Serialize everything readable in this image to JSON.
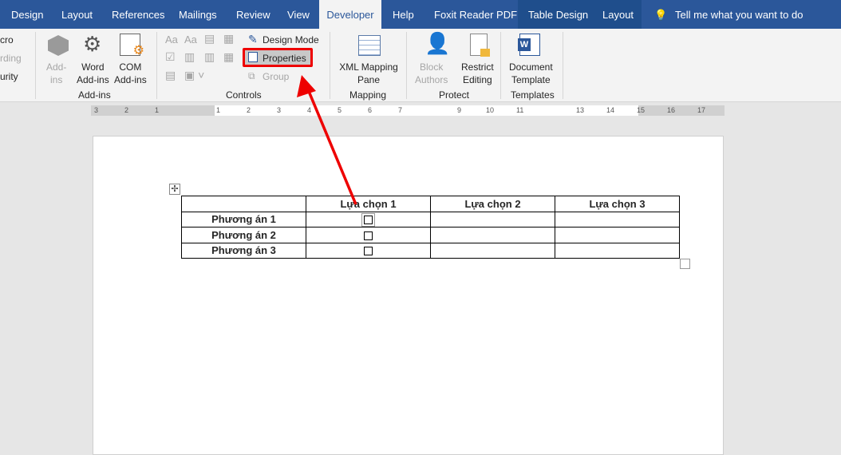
{
  "tabs": [
    "Design",
    "Layout",
    "References",
    "Mailings",
    "Review",
    "View",
    "Developer",
    "Help",
    "Foxit Reader PDF",
    "Table Design",
    "Layout"
  ],
  "tell_me": "Tell me what you want to do",
  "ribbon": {
    "code": {
      "macro": "cro",
      "recording": "rding",
      "security": "urity"
    },
    "addins": {
      "addins": [
        "Add-",
        "ins"
      ],
      "word": [
        "Word",
        "Add-ins"
      ],
      "com": [
        "COM",
        "Add-ins"
      ],
      "label": "Add-ins"
    },
    "controls": {
      "design_mode": "Design Mode",
      "properties": "Properties",
      "group": "Group",
      "label": "Controls"
    },
    "mapping": {
      "xml": [
        "XML Mapping",
        "Pane"
      ],
      "label": "Mapping"
    },
    "protect": {
      "block": [
        "Block",
        "Authors"
      ],
      "restrict": [
        "Restrict",
        "Editing"
      ],
      "label": "Protect"
    },
    "templates": {
      "doc": [
        "Document",
        "Template"
      ],
      "label": "Templates"
    }
  },
  "ruler": [
    "3",
    "2",
    "1",
    "1",
    "2",
    "3",
    "4",
    "5",
    "6",
    "7",
    "9",
    "10",
    "11",
    "13",
    "14",
    "15",
    "16",
    "17"
  ],
  "table": {
    "headers": [
      "",
      "Lựa chọn 1",
      "Lựa chọn 2",
      "Lựa chọn 3"
    ],
    "rows": [
      "Phương án 1",
      "Phương án 2",
      "Phương án 3"
    ]
  },
  "colors": {
    "accent": "#2b579a",
    "highlight": "#e00000"
  }
}
